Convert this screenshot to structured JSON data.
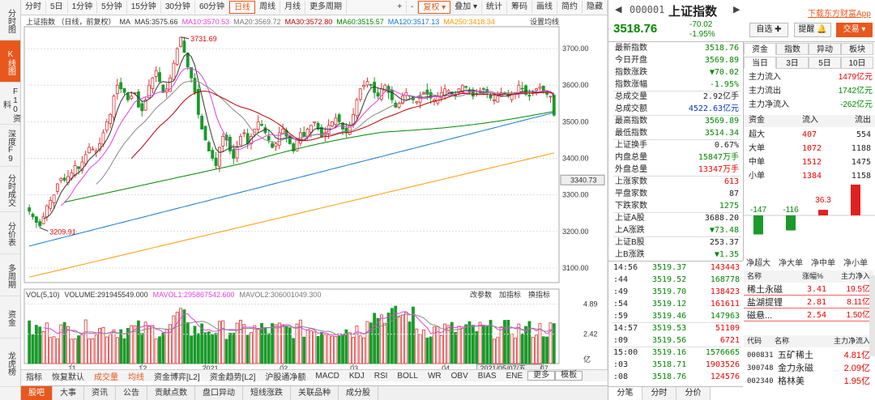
{
  "left_tabs": [
    "分时图",
    "K线图",
    "F10资料",
    "深度F9",
    "分时成交",
    "分价表",
    "多周期",
    "资金",
    "龙虎榜"
  ],
  "toolbar": {
    "items": [
      "分时",
      "5日",
      "1分钟",
      "5分钟",
      "15分钟",
      "30分钟",
      "60分钟",
      "日线",
      "周线",
      "月线",
      "更多周期"
    ],
    "selected": "日线",
    "right": [
      "+",
      "-",
      "复权",
      "叠加",
      "统计",
      "筹码",
      "画线",
      "简约",
      "隐藏"
    ],
    "selected_right": "复权"
  },
  "ma_legend": {
    "name": "上证指数 （日线，前复权）",
    "items": [
      {
        "label": "MA",
        "color": "#333"
      },
      {
        "label": "MA5:3575.66",
        "color": "#333"
      },
      {
        "label": "MA10:3570.53",
        "color": "#e040e0"
      },
      {
        "label": "MA20:3569.72",
        "color": "#777"
      },
      {
        "label": "MA30:3572.80",
        "color": "#b00"
      },
      {
        "label": "MA60:3515.57",
        "color": "#080"
      },
      {
        "label": "MA120:3517.13",
        "color": "#17c"
      },
      {
        "label": "MA250:3418.34",
        "color": "#f90"
      }
    ],
    "settings": "设置均线"
  },
  "price_axis": [
    "3700.00",
    "3600.00",
    "3500.00",
    "3400.00",
    "3300.00",
    "3200.00",
    "3100.00"
  ],
  "axis_tag": "3340.73",
  "high_label": "3731.69",
  "low_label": "3209.91",
  "vol_legend": {
    "items": [
      {
        "label": "VOL(5,10)",
        "color": "#333"
      },
      {
        "label": "VOLUME:291945549.000",
        "color": "#333"
      },
      {
        "label": "MAVOL1:295867542.600",
        "color": "#e040e0"
      },
      {
        "label": "MAVOL2:306001049.300",
        "color": "#777"
      }
    ],
    "actions": [
      "改参数",
      "加指标",
      "换指标"
    ]
  },
  "vol_axis": [
    "4.89",
    "2.42",
    "亿"
  ],
  "date_axis": [
    "11",
    "12",
    "2021",
    "02",
    "03",
    "04",
    "2021/05/07/五",
    "07"
  ],
  "index_tabs": [
    "指标",
    "恢复默认",
    "成交量",
    "均线",
    "资金博弈[L2]",
    "资金趋势[L2]",
    "沪股通净额",
    "MACD",
    "KDJ",
    "RSI",
    "BOLL",
    "WR",
    "OBV",
    "BIAS",
    "ENE",
    "更多",
    "模板"
  ],
  "bottom_nav": [
    "股吧",
    "大事",
    "资讯",
    "公告",
    "贡献点数",
    "盘口异动",
    "短线涨跌",
    "关联品种",
    "成分股"
  ],
  "header": {
    "code": "000001",
    "name": "上证指数",
    "link": "下载东方财富App",
    "price": "3518.76",
    "change": "-70.02",
    "pct": "-1.95%",
    "buttons": [
      "自选",
      "提醒",
      "交易"
    ]
  },
  "quote": [
    {
      "k": "最新指数",
      "v": "3518.76",
      "c": "green"
    },
    {
      "k": "今日开盘",
      "v": "3569.89",
      "c": "green"
    },
    {
      "k": "指数涨跌",
      "v": "▼70.02",
      "c": "green"
    },
    {
      "k": "指数涨幅",
      "v": "-1.95%",
      "c": "green"
    },
    {
      "k": "总成交量",
      "v": "2.92亿手",
      "c": "black"
    },
    {
      "k": "总成交额",
      "v": "4522.63亿元",
      "c": "blue"
    },
    {
      "k": "最高指数",
      "v": "3569.89",
      "c": "green"
    },
    {
      "k": "最低指数",
      "v": "3514.34",
      "c": "green"
    },
    {
      "k": "上证换手",
      "v": "0.67%",
      "c": "black"
    },
    {
      "k": "内盘总量",
      "v": "15847万手",
      "c": "green"
    },
    {
      "k": "外盘总量",
      "v": "13347万手",
      "c": "red"
    },
    {
      "k": "上涨家数",
      "v": "613",
      "c": "red"
    },
    {
      "k": "平盘家数",
      "v": "87",
      "c": "black"
    },
    {
      "k": "下跌家数",
      "v": "1275",
      "c": "green"
    },
    {
      "k": "上证A股",
      "v": "3688.20",
      "c": "black"
    },
    {
      "k": "上A涨跌",
      "v": "▼73.48",
      "c": "green"
    },
    {
      "k": "上证B股",
      "v": "253.37",
      "c": "black"
    },
    {
      "k": "上B涨跌",
      "v": "▼1.35",
      "c": "green"
    }
  ],
  "ticks": [
    {
      "t": "14:56",
      "p": "3519.37",
      "v": "143443"
    },
    {
      "t": ":44",
      "p": "3519.52",
      "v": "168778"
    },
    {
      "t": ":49",
      "p": "3519.70",
      "v": "138423"
    },
    {
      "t": ":54",
      "p": "3519.12",
      "v": "161611"
    },
    {
      "t": ":59",
      "p": "3519.46",
      "v": "147963"
    },
    {
      "t": "14:57",
      "p": "3519.53",
      "v": "51109"
    },
    {
      "t": ":09",
      "p": "3519.56",
      "v": "6721"
    },
    {
      "t": "15:00",
      "p": "3519.16",
      "v": "1576665"
    },
    {
      "t": ":03",
      "p": "3518.71",
      "v": "1903526"
    },
    {
      "t": ":08",
      "p": "3518.76",
      "v": "124576"
    }
  ],
  "tick_tabs": [
    "分笔",
    "分时",
    "分价"
  ],
  "fund_tabs": [
    "资金",
    "指数",
    "异动",
    "板块"
  ],
  "fund_periods": [
    "当日",
    "3日",
    "5日",
    "10日"
  ],
  "fund_flow": [
    {
      "k": "主力流入",
      "v": "1479亿元",
      "c": "red"
    },
    {
      "k": "主力流出",
      "v": "1742亿元",
      "c": "green"
    },
    {
      "k": "主力净流入",
      "v": "-262亿元",
      "c": "green"
    }
  ],
  "flow_table": {
    "headers": [
      "资金",
      "流入",
      "流出"
    ],
    "rows": [
      {
        "k": "超大",
        "in": "407",
        "out": "554"
      },
      {
        "k": "大单",
        "in": "1072",
        "out": "1188"
      },
      {
        "k": "中单",
        "in": "1512",
        "out": "1475"
      },
      {
        "k": "小单",
        "in": "1384",
        "out": "1158"
      }
    ]
  },
  "net_bars": {
    "labels": [
      "净超大",
      "净大单",
      "净中单",
      "净小单"
    ],
    "values": [
      "-147",
      "-116",
      "36.3",
      "226"
    ],
    "nums": [
      -147,
      -116,
      36.3,
      226
    ]
  },
  "sector_table": {
    "headers": [
      "名称",
      "涨幅%",
      "主力净入"
    ],
    "rows": [
      {
        "n": "稀土永磁",
        "p": "3.41",
        "v": "19.5亿"
      },
      {
        "n": "盐湖提锂",
        "p": "2.81",
        "v": "8.11亿"
      },
      {
        "n": "磁悬...",
        "p": "2.54",
        "v": "1.50亿"
      }
    ]
  },
  "stock_table": {
    "headers": [
      "代码",
      "名称",
      "主力净流入"
    ],
    "rows": [
      {
        "c": "000831",
        "n": "五矿稀土",
        "v": "4.81亿"
      },
      {
        "c": "300748",
        "n": "金力永磁",
        "v": "2.09亿"
      },
      {
        "c": "002340",
        "n": "格林美",
        "v": "1.95亿"
      }
    ]
  },
  "chart_data": {
    "type": "candlestick",
    "title": "上证指数",
    "price_range": [
      3060,
      3760
    ],
    "x_labels": [
      "11",
      "12",
      "2021",
      "02",
      "03",
      "04",
      "2021/05/07/五",
      "07"
    ],
    "high": 3731.69,
    "low": 3209.91,
    "volume_range": [
      0,
      5.2
    ],
    "volume_unit": "亿"
  }
}
